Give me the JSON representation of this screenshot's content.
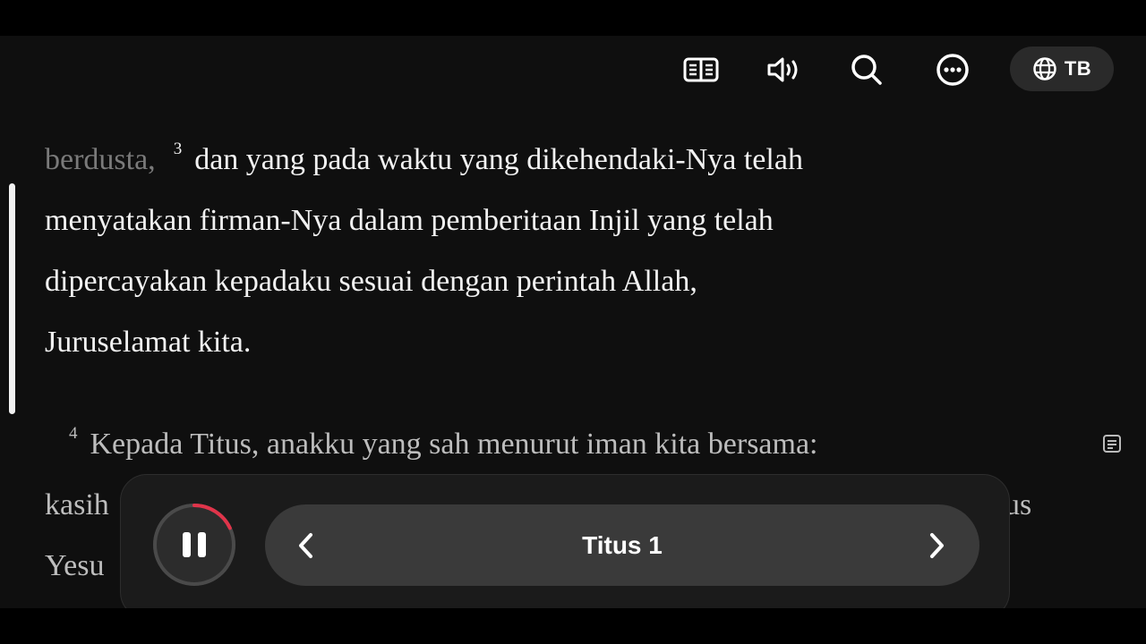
{
  "toolbar": {
    "icons": [
      "parallel-book-icon",
      "audio-icon",
      "search-icon",
      "more-icon",
      "globe-icon"
    ],
    "version_label": "TB"
  },
  "reader": {
    "line1_prefix": "berdusta,",
    "verse3_number": "3",
    "line1_text": "dan yang pada waktu yang dikehendaki-Nya telah",
    "line2": "menyatakan firman-Nya dalam pemberitaan Injil yang telah",
    "line3": "dipercayakan kepadaku sesuai dengan perintah Allah,",
    "line4": "Juruselamat kita.",
    "verse4_number": "4",
    "verse4_line1": "Kepada Titus, anakku yang sah menurut iman kita bersama:",
    "verse4_line2_start": "kasih",
    "verse4_line2_end": "us",
    "verse4_line3_start": "Yesu"
  },
  "player": {
    "state": "playing",
    "progress": 0.18,
    "chapter_title": "Titus 1",
    "accent_color": "#e0344a"
  }
}
